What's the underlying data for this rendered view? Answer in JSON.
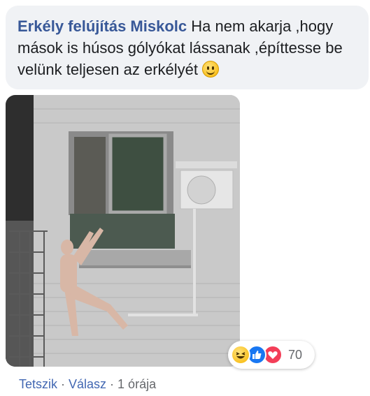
{
  "comment": {
    "author": "Erkély felújítás Miskolc",
    "text": "Ha nem akarja ,hogy mások is húsos gólyókat lássanak ,építtesse be velünk teljesen az erkélyét",
    "emoji": "slightly-smiling-face-icon"
  },
  "reactions": {
    "icons": [
      "haha-reaction-icon",
      "like-reaction-icon",
      "love-reaction-icon"
    ],
    "count": "70"
  },
  "actions": {
    "like": "Tetszik",
    "reply": "Válasz",
    "separator": "·",
    "time": "1 órája"
  },
  "colors": {
    "bubble": "#f0f2f5",
    "author": "#385898",
    "link": "#4267b2",
    "meta": "#65676b"
  }
}
